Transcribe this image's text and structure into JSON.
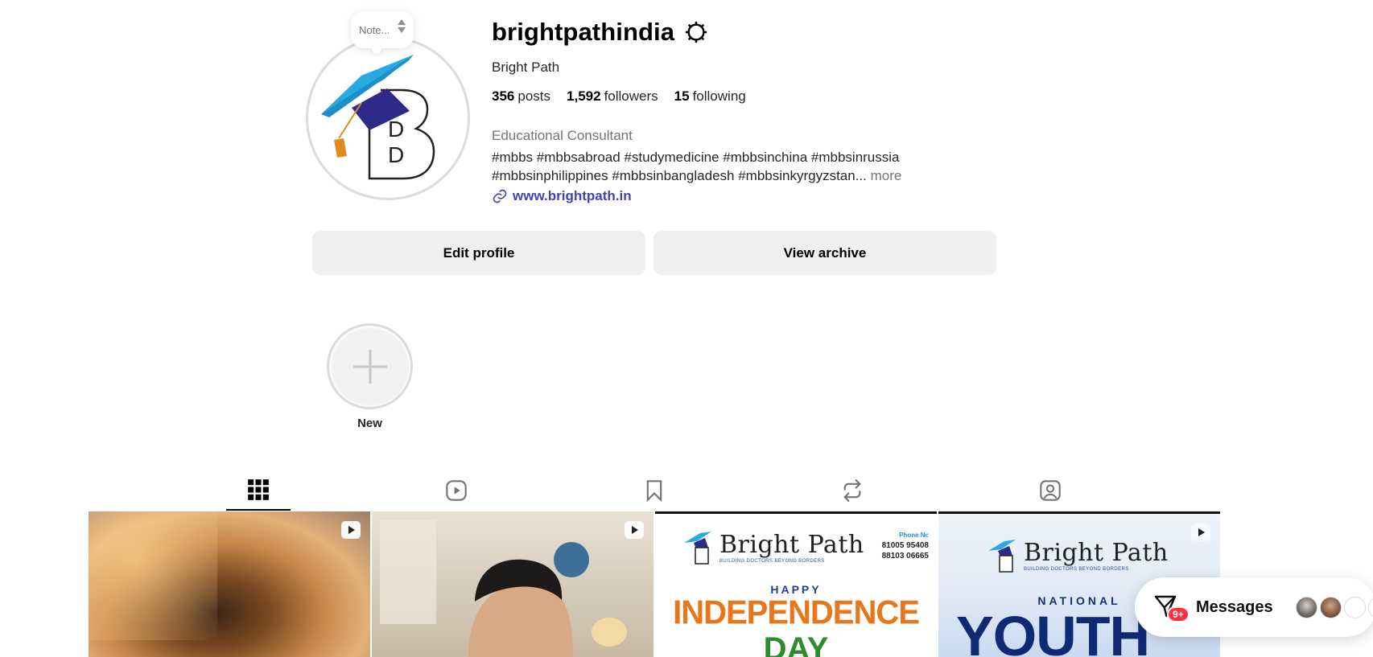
{
  "profile": {
    "note_text": "Note...",
    "username": "brightpathindia",
    "full_name": "Bright Path",
    "stats": {
      "posts_count": "356",
      "posts_label": "posts",
      "followers_count": "1,592",
      "followers_label": "followers",
      "following_count": "15",
      "following_label": "following"
    },
    "category": "Educational Consultant",
    "bio_line1": "#mbbs #mbbsabroad #studymedicine #mbbsinchina #mbbsinrussia",
    "bio_line2": "#mbbsinphilippines #mbbsinbangladesh #mbbsinkyrgyzstan...",
    "more_label": "more",
    "website": "www.brightpath.in",
    "avatar_letter": "B"
  },
  "actions": {
    "edit_profile": "Edit profile",
    "view_archive": "View archive"
  },
  "highlights": {
    "new_label": "New"
  },
  "tabs": [
    {
      "icon": "grid-icon",
      "active": true
    },
    {
      "icon": "reels-icon",
      "active": false
    },
    {
      "icon": "saved-icon",
      "active": false
    },
    {
      "icon": "reposts-icon",
      "active": false
    },
    {
      "icon": "tagged-icon",
      "active": false
    }
  ],
  "posts": [
    {
      "type": "reel"
    },
    {
      "type": "reel"
    },
    {
      "type": "image",
      "brand": "Bright Path",
      "tagline": "BUILDING DOCTORS BEYOND BORDERS",
      "phone_label": "Phone Nc",
      "phone1": "81005 95408",
      "phone2": "88103 06665",
      "happy": "HAPPY",
      "headline": "INDEPENDENCE",
      "sub": "DAY"
    },
    {
      "type": "reel",
      "brand": "Bright Path",
      "tagline": "BUILDING DOCTORS BEYOND BORDERS",
      "national": "NATIONAL",
      "headline": "YOUTH"
    }
  ],
  "messages": {
    "label": "Messages",
    "badge": "9+"
  },
  "colors": {
    "link": "#3f44b5",
    "button_bg": "#efefef",
    "badge": "#ff3040"
  }
}
